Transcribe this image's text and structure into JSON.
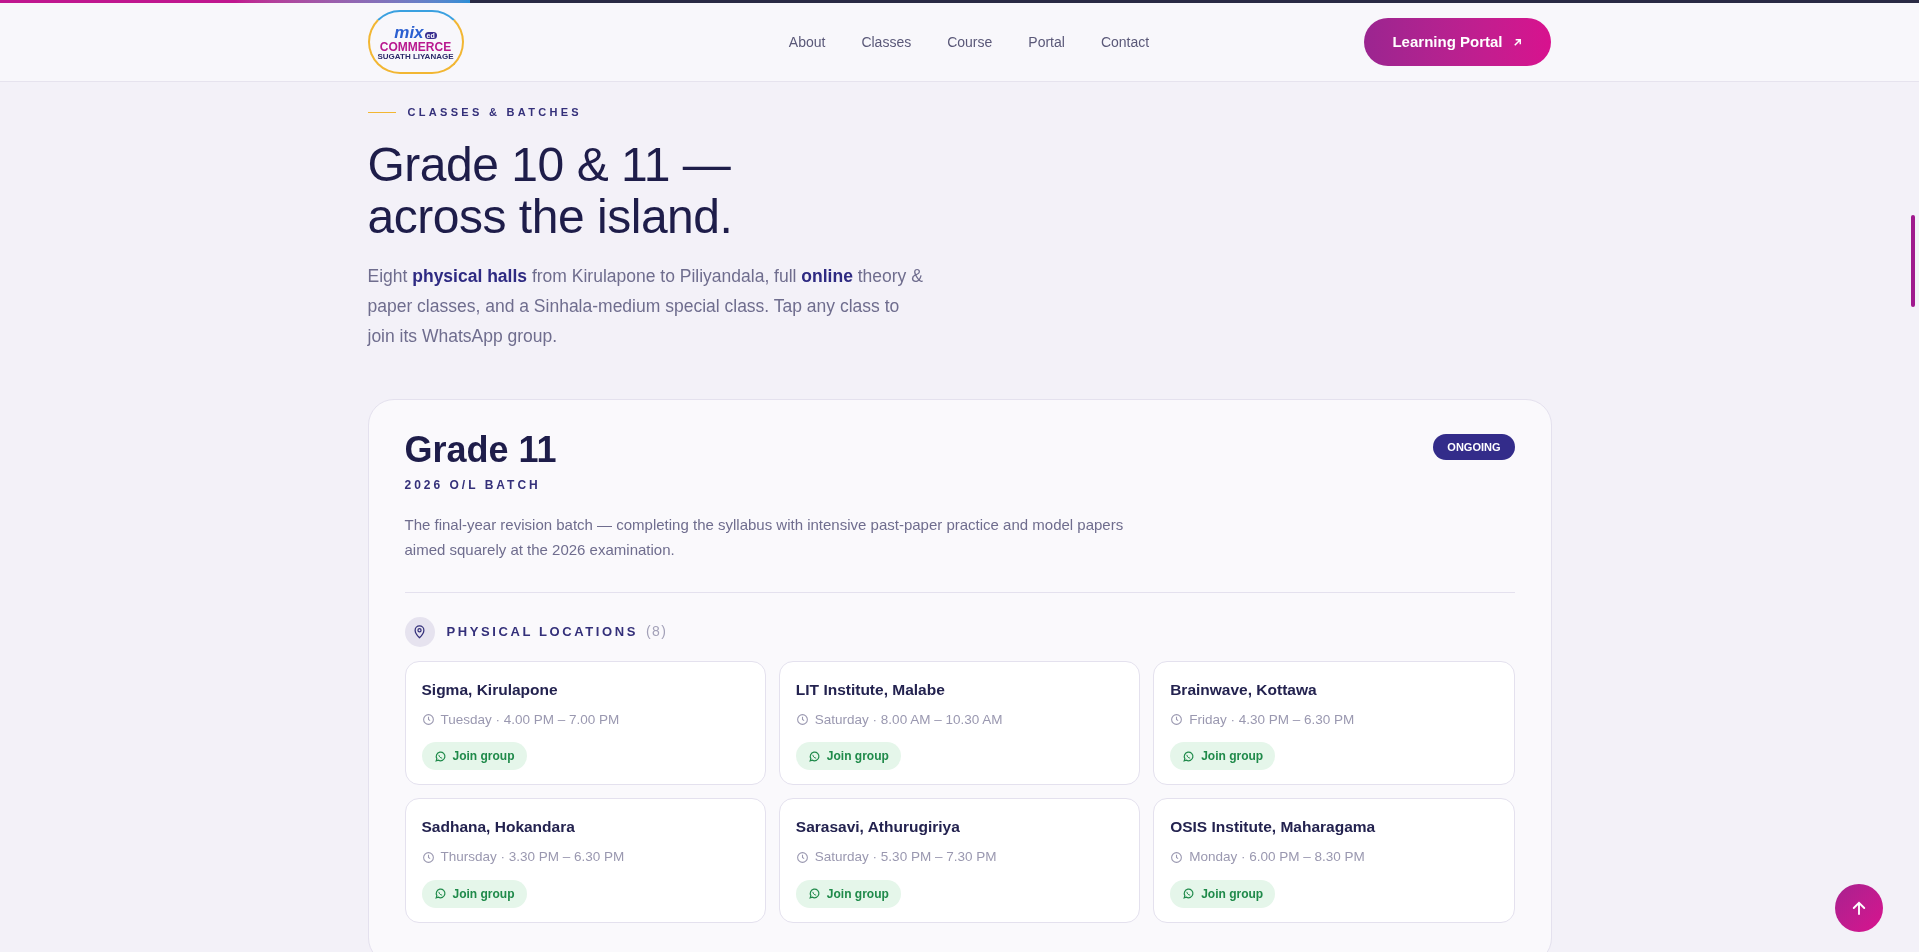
{
  "logo": {
    "top": "mix",
    "badge": "ed",
    "main": "COMMERCE",
    "sub": "SUGATH LIYANAGE"
  },
  "nav": [
    {
      "label": "About"
    },
    {
      "label": "Classes"
    },
    {
      "label": "Course"
    },
    {
      "label": "Portal"
    },
    {
      "label": "Contact"
    }
  ],
  "cta": {
    "label": "Learning Portal"
  },
  "scroll_progress": {
    "level": 0.245
  },
  "hero": {
    "eyebrow": "CLASSES & BATCHES",
    "title_lines": [
      "Grade 10 & 11 —",
      "across the island."
    ],
    "intro": "Eight **physical halls** from Kirulapone to Piliyandala, full **online** theory & paper classes, and a Sinhala-medium special class. Tap any class to join its WhatsApp group."
  },
  "batch": {
    "title": "Grade 11",
    "subtitle": "2026 O/L BATCH",
    "status": "ONGOING",
    "description": "The final-year revision batch — completing the syllabus with intensive past-paper practice and model papers aimed squarely at the 2026 examination.",
    "locations_heading": "PHYSICAL LOCATIONS",
    "locations_count": "(8)",
    "locations": [
      {
        "name": "Sigma, Kirulapone",
        "schedule": "Tuesday · 4.00 PM – 7.00 PM",
        "action": "Join group"
      },
      {
        "name": "LIT Institute, Malabe",
        "schedule": "Saturday · 8.00 AM – 10.30 AM",
        "action": "Join group"
      },
      {
        "name": "Brainwave, Kottawa",
        "schedule": "Friday · 4.30 PM – 6.30 PM",
        "action": "Join group"
      },
      {
        "name": "Sadhana, Hokandara",
        "schedule": "Thursday · 3.30 PM – 6.30 PM",
        "action": "Join group"
      },
      {
        "name": "Sarasavi, Athurugiriya",
        "schedule": "Saturday · 5.30 PM – 7.30 PM",
        "action": "Join group"
      },
      {
        "name": "OSIS Institute, Maharagama",
        "schedule": "Monday · 6.00 PM – 8.30 PM",
        "action": "Join group"
      }
    ]
  }
}
